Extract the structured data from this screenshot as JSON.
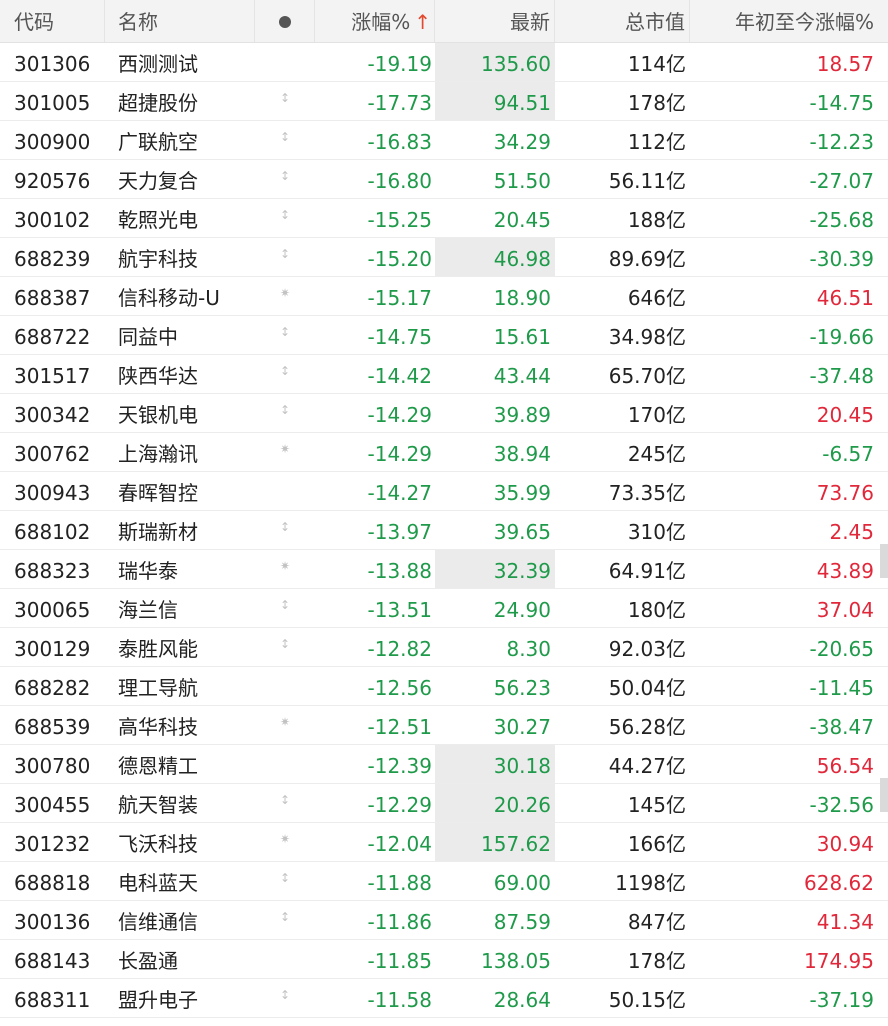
{
  "header": {
    "code": "代码",
    "name": "名称",
    "pct": "涨幅%",
    "sort_arrow": "↑",
    "last": "最新",
    "cap": "总市值",
    "ytd": "年初至今涨幅%"
  },
  "colors": {
    "down": "#1f9a4a",
    "up": "#e0283a",
    "sort_arrow": "#e2492f"
  },
  "rows": [
    {
      "code": "301306",
      "name": "西测测试",
      "indicator": "none",
      "pct": "-19.19",
      "last": "135.60",
      "cap": "114亿",
      "ytd": "18.57",
      "ytd_dir": "up",
      "last_highlight": true
    },
    {
      "code": "301005",
      "name": "超捷股份",
      "indicator": "updown-icon",
      "pct": "-17.73",
      "last": "94.51",
      "cap": "178亿",
      "ytd": "-14.75",
      "ytd_dir": "down",
      "last_highlight": true
    },
    {
      "code": "300900",
      "name": "广联航空",
      "indicator": "updown-icon",
      "pct": "-16.83",
      "last": "34.29",
      "cap": "112亿",
      "ytd": "-12.23",
      "ytd_dir": "down",
      "last_highlight": false
    },
    {
      "code": "920576",
      "name": "天力复合",
      "indicator": "updown-icon",
      "pct": "-16.80",
      "last": "51.50",
      "cap": "56.11亿",
      "ytd": "-27.07",
      "ytd_dir": "down",
      "last_highlight": false
    },
    {
      "code": "300102",
      "name": "乾照光电",
      "indicator": "updown-icon",
      "pct": "-15.25",
      "last": "20.45",
      "cap": "188亿",
      "ytd": "-25.68",
      "ytd_dir": "down",
      "last_highlight": false
    },
    {
      "code": "688239",
      "name": "航宇科技",
      "indicator": "updown-icon",
      "pct": "-15.20",
      "last": "46.98",
      "cap": "89.69亿",
      "ytd": "-30.39",
      "ytd_dir": "down",
      "last_highlight": true
    },
    {
      "code": "688387",
      "name": "信科移动-U",
      "indicator": "asterisk-icon",
      "pct": "-15.17",
      "last": "18.90",
      "cap": "646亿",
      "ytd": "46.51",
      "ytd_dir": "up",
      "last_highlight": false
    },
    {
      "code": "688722",
      "name": "同益中",
      "indicator": "updown-icon",
      "pct": "-14.75",
      "last": "15.61",
      "cap": "34.98亿",
      "ytd": "-19.66",
      "ytd_dir": "down",
      "last_highlight": false
    },
    {
      "code": "301517",
      "name": "陕西华达",
      "indicator": "updown-icon",
      "pct": "-14.42",
      "last": "43.44",
      "cap": "65.70亿",
      "ytd": "-37.48",
      "ytd_dir": "down",
      "last_highlight": false
    },
    {
      "code": "300342",
      "name": "天银机电",
      "indicator": "updown-icon",
      "pct": "-14.29",
      "last": "39.89",
      "cap": "170亿",
      "ytd": "20.45",
      "ytd_dir": "up",
      "last_highlight": false
    },
    {
      "code": "300762",
      "name": "上海瀚讯",
      "indicator": "asterisk-icon",
      "pct": "-14.29",
      "last": "38.94",
      "cap": "245亿",
      "ytd": "-6.57",
      "ytd_dir": "down",
      "last_highlight": false
    },
    {
      "code": "300943",
      "name": "春晖智控",
      "indicator": "none",
      "pct": "-14.27",
      "last": "35.99",
      "cap": "73.35亿",
      "ytd": "73.76",
      "ytd_dir": "up",
      "last_highlight": false
    },
    {
      "code": "688102",
      "name": "斯瑞新材",
      "indicator": "updown-icon",
      "pct": "-13.97",
      "last": "39.65",
      "cap": "310亿",
      "ytd": "2.45",
      "ytd_dir": "up",
      "last_highlight": false
    },
    {
      "code": "688323",
      "name": "瑞华泰",
      "indicator": "asterisk-icon",
      "pct": "-13.88",
      "last": "32.39",
      "cap": "64.91亿",
      "ytd": "43.89",
      "ytd_dir": "up",
      "last_highlight": true
    },
    {
      "code": "300065",
      "name": "海兰信",
      "indicator": "updown-icon",
      "pct": "-13.51",
      "last": "24.90",
      "cap": "180亿",
      "ytd": "37.04",
      "ytd_dir": "up",
      "last_highlight": false
    },
    {
      "code": "300129",
      "name": "泰胜风能",
      "indicator": "updown-icon",
      "pct": "-12.82",
      "last": "8.30",
      "cap": "92.03亿",
      "ytd": "-20.65",
      "ytd_dir": "down",
      "last_highlight": false
    },
    {
      "code": "688282",
      "name": "理工导航",
      "indicator": "none",
      "pct": "-12.56",
      "last": "56.23",
      "cap": "50.04亿",
      "ytd": "-11.45",
      "ytd_dir": "down",
      "last_highlight": false
    },
    {
      "code": "688539",
      "name": "高华科技",
      "indicator": "asterisk-icon",
      "pct": "-12.51",
      "last": "30.27",
      "cap": "56.28亿",
      "ytd": "-38.47",
      "ytd_dir": "down",
      "last_highlight": false
    },
    {
      "code": "300780",
      "name": "德恩精工",
      "indicator": "none",
      "pct": "-12.39",
      "last": "30.18",
      "cap": "44.27亿",
      "ytd": "56.54",
      "ytd_dir": "up",
      "last_highlight": true
    },
    {
      "code": "300455",
      "name": "航天智装",
      "indicator": "updown-icon",
      "pct": "-12.29",
      "last": "20.26",
      "cap": "145亿",
      "ytd": "-32.56",
      "ytd_dir": "down",
      "last_highlight": true
    },
    {
      "code": "301232",
      "name": "飞沃科技",
      "indicator": "asterisk-icon",
      "pct": "-12.04",
      "last": "157.62",
      "cap": "166亿",
      "ytd": "30.94",
      "ytd_dir": "up",
      "last_highlight": true
    },
    {
      "code": "688818",
      "name": "电科蓝天",
      "indicator": "updown-icon",
      "pct": "-11.88",
      "last": "69.00",
      "cap": "1198亿",
      "ytd": "628.62",
      "ytd_dir": "up",
      "last_highlight": false
    },
    {
      "code": "300136",
      "name": "信维通信",
      "indicator": "updown-icon",
      "pct": "-11.86",
      "last": "87.59",
      "cap": "847亿",
      "ytd": "41.34",
      "ytd_dir": "up",
      "last_highlight": false
    },
    {
      "code": "688143",
      "name": "长盈通",
      "indicator": "none",
      "pct": "-11.85",
      "last": "138.05",
      "cap": "178亿",
      "ytd": "174.95",
      "ytd_dir": "up",
      "last_highlight": false
    },
    {
      "code": "688311",
      "name": "盟升电子",
      "indicator": "updown-icon",
      "pct": "-11.58",
      "last": "28.64",
      "cap": "50.15亿",
      "ytd": "-37.19",
      "ytd_dir": "down",
      "last_highlight": false
    }
  ]
}
